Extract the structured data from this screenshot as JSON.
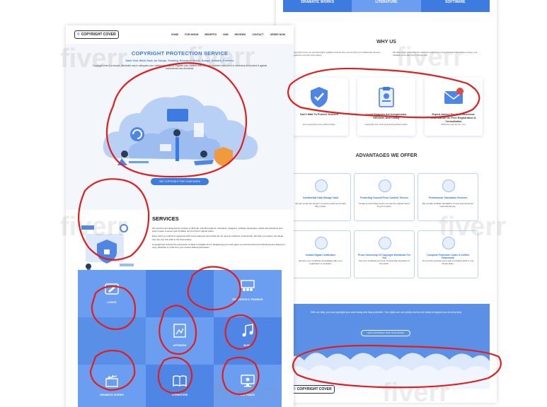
{
  "left_page": {
    "logo": "COPYRIGHT COVER",
    "nav": [
      "HOME",
      "FOR WHOM",
      "BENEFITS",
      "HUB",
      "REVIEWS",
      "CONTACT",
      "ORDER NOW"
    ],
    "hero": {
      "title": "COPYRIGHT PROTECTION SERVICE",
      "subtitle": "Save Your Work Such As Songs, Training, Research Music, Songs, Artwork, Portfolio",
      "description": "Copyright cover is a simple, affordable way to safeguard your intellectual property. Register your creative work today to establish clear proof of ownership and protect it against unauthorised use worldwide.",
      "button": "GET COPYRIGHT FOR YOUR WORK"
    },
    "services": {
      "title": "SERVICES",
      "paragraphs": [
        "Our services are designed for creators of all kinds, including authors, musicians, designers, software developers, artists and educators who want to keep a secure and verifiable record of their original works.",
        "Every work you submit is registered with a time-stamped record that can be used as evidence of ownership. We help you protect your ideas from the very first draft to the final release.",
        "Copyright law protects the expression of ideas in tangible forms. Registering your work gives you documented proof should anyone attempt to copy, distribute or profit from your content without permission."
      ]
    },
    "grid": {
      "cells": [
        {
          "label": "LOGOS"
        },
        {
          "label": ""
        },
        {
          "label": "EDUCATION & TRAINING"
        },
        {
          "label": ""
        },
        {
          "label": "ARTWORK"
        },
        {
          "label": "MUSIC"
        },
        {
          "label": "DRAMATIC WORKS"
        },
        {
          "label": "LITERATURE"
        },
        {
          "label": "SOFTWARE"
        }
      ],
      "colors": [
        "#6b9ef0",
        "#4f86e6",
        "#6b9ef0",
        "#5a8fe8",
        "#6b9ef0",
        "#4f86e6",
        "#6b9ef0",
        "#4f86e6",
        "#6b9ef0"
      ]
    }
  },
  "right_page": {
    "tabs": [
      {
        "label": "DRAMATIC WORKS",
        "color": "#3e7be0"
      },
      {
        "label": "LITERATURE",
        "color": "#6b9ef0"
      },
      {
        "label": "SOFTWARE",
        "color": "#3e7be0"
      }
    ],
    "why_us": {
      "title": "WHY US",
      "left_text": "At Copyright Cover we provide highly qualified experts who ensure that your intellectual property is registered correctly and quickly.",
      "right_text": "We have been protecting the rights of creators for many years and know how to keep your valuable work safe from infringement.",
      "cards": [
        {
          "title": "Don't Wait To Protect Yourself",
          "desc": "Get Copyright Cover without delay."
        },
        {
          "title": "Local Disputes Are Inexpensive, Efficient, And Costly",
          "desc": "Copyright your work and avoid problems later."
        },
        {
          "title": "Expert Advice For Your Business: Information On Free Registration & Consultation",
          "desc": "What We Can Do For You."
        }
      ]
    },
    "advantages": {
      "title": "ADVANTAGES WE OFFER",
      "cards": [
        {
          "title": "Confidential Data Storage Vault",
          "desc": "All your works are stored in a secure vault and remain fully private."
        },
        {
          "title": "Protecting Yourself From Content Thieves",
          "desc": "Create a record that proves you are the original owner of your content."
        },
        {
          "title": "Professional Translation Services",
          "desc": "We provide certified translations of your documents for international use."
        },
        {
          "title": "Instant Digital Certificates",
          "desc": "Receive your certificate immediately after your registration is complete."
        },
        {
          "title": "Prove Ownership Of Copyright Worldwide For You",
          "desc": "Use your certificate as proof of ownership anywhere in the world."
        },
        {
          "title": "Complete Protection Under A Unified Framework",
          "desc": "Our service protects every type of creative work in one simple place."
        }
      ]
    },
    "cta": {
      "text": "With our help, you can copyright your work today and stay protected. Your rights are our priority and we are ready to support you at every step.",
      "button": "GET COPYRIGHT FOR YOUR WORK"
    },
    "footer_logo": "COPYRIGHT COVER"
  },
  "colors": {
    "brand_blue": "#3e7be0",
    "light_blue": "#6b9ef0",
    "annotation_red": "#e01e1e"
  }
}
